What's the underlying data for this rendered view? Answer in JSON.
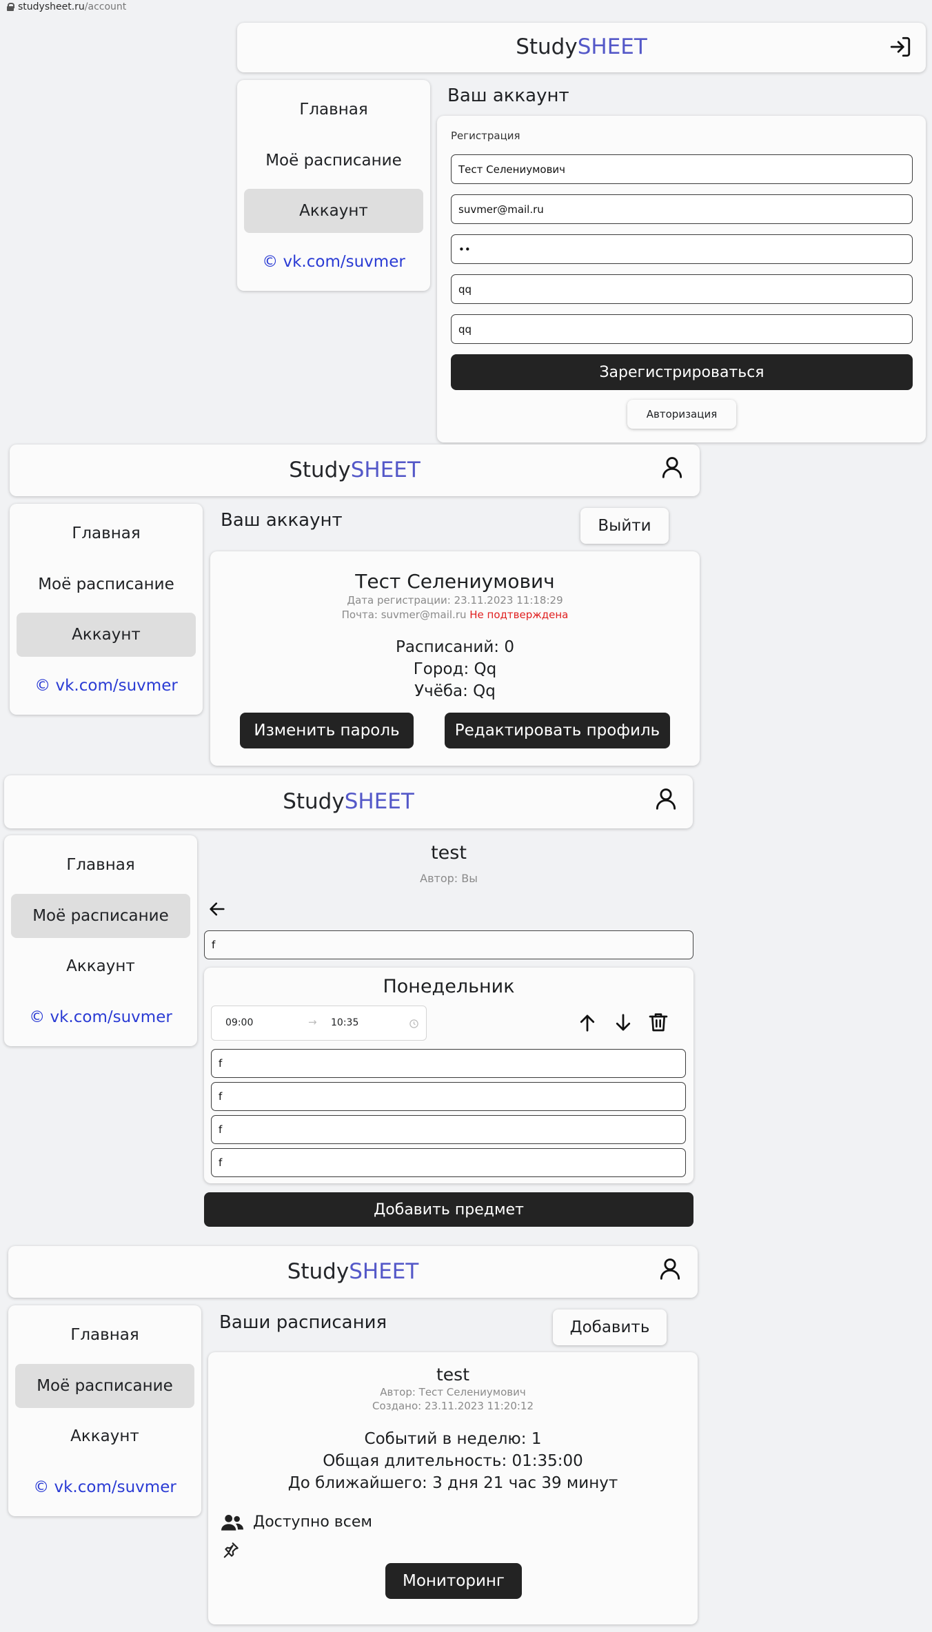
{
  "browser": {
    "host": "studysheet.ru",
    "path": "/account"
  },
  "brand": {
    "study": "Study",
    "sheet": "SHEET"
  },
  "colors": {
    "accent": "#5458c8",
    "link": "#2a3bd4",
    "dark_button": "#232323",
    "warning": "#e02020"
  },
  "nav": {
    "home": "Главная",
    "schedule": "Моё расписание",
    "account": "Аккаунт",
    "link": "© vk.com/suvmer"
  },
  "icons": {
    "login": "login-icon",
    "user": "user-icon",
    "arrow_left": "arrow-left-icon",
    "arrow_up": "arrow-up-icon",
    "arrow_down": "arrow-down-icon",
    "trash": "trash-icon",
    "clock": "clock-icon",
    "users": "users-icon",
    "pin": "pin-icon",
    "lock": "lock-icon"
  },
  "s1": {
    "title": "Ваш аккаунт",
    "form_label": "Регистрация",
    "name_value": "Тест Селениумович",
    "email_value": "suvmer@mail.ru",
    "password_value": "••",
    "city_value": "qq",
    "study_value": "qq",
    "register_button": "Зарегистрироваться",
    "auth_button": "Авторизация"
  },
  "s2": {
    "title": "Ваш аккаунт",
    "logout_button": "Выйти",
    "name": "Тест Селениумович",
    "reg_date": "Дата регистрации: 23.11.2023 11:18:29",
    "mail_prefix": "Почта: suvmer@mail.ru ",
    "mail_status": "Не подтверждена",
    "schedules": "Расписаний: 0",
    "city": "Город: Qq",
    "study": "Учёба: Qq",
    "change_password_button": "Изменить пароль",
    "edit_profile_button": "Редактировать профиль"
  },
  "s3": {
    "title": "test",
    "author": "Автор: Вы",
    "schedule_name_value": "f",
    "day": "Понедельник",
    "time_start": "09:00",
    "time_arrow": "→",
    "time_end": "10:35",
    "fields": [
      "f",
      "f",
      "f",
      "f"
    ],
    "add_subject_button": "Добавить предмет"
  },
  "s4": {
    "title": "Ваши расписания",
    "add_button": "Добавить",
    "schedule_title": "test",
    "author": "Автор: Тест Селениумович",
    "created": "Создано: 23.11.2023 11:20:12",
    "events": "Событий в неделю: 1",
    "duration": "Общая длительность: 01:35:00",
    "nearest": "До ближайшего: 3 дня 21 час 39 минут",
    "access": "Доступно всем",
    "monitor_button": "Мониторинг"
  }
}
